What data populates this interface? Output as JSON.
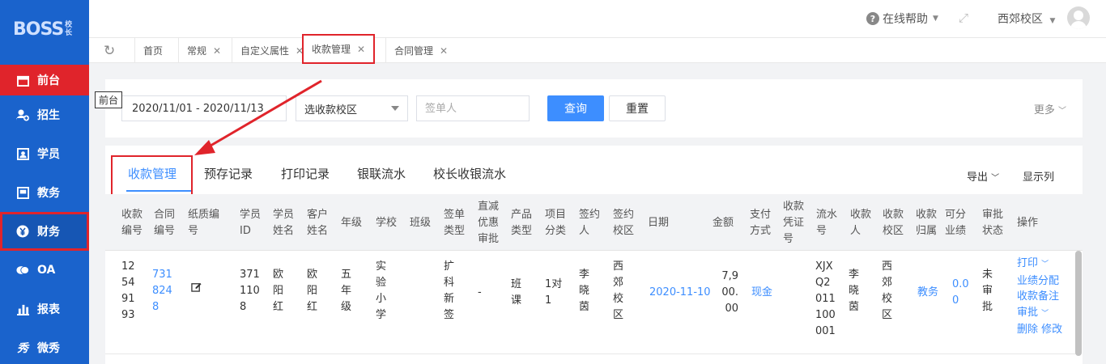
{
  "app": {
    "logo_text": "BOSS",
    "logo_sub": "校长"
  },
  "sidebar": {
    "items": [
      {
        "label": "前台",
        "icon": "calendar-icon"
      },
      {
        "label": "招生",
        "icon": "user-add-icon"
      },
      {
        "label": "学员",
        "icon": "id-card-icon"
      },
      {
        "label": "教务",
        "icon": "book-icon"
      },
      {
        "label": "财务",
        "icon": "yen-icon"
      },
      {
        "label": "OA",
        "icon": "chat-icon"
      },
      {
        "label": "报表",
        "icon": "bar-chart-icon"
      },
      {
        "label": "微秀",
        "icon": "xiu-icon"
      }
    ],
    "tooltip": "前台"
  },
  "header": {
    "help": "在线帮助",
    "campus": "西郊校区"
  },
  "page_tabs": [
    {
      "label": "首页",
      "closable": false
    },
    {
      "label": "常规",
      "closable": true
    },
    {
      "label": "自定义属性",
      "closable": true
    },
    {
      "label": "收款管理",
      "closable": true
    },
    {
      "label": "合同管理",
      "closable": true
    }
  ],
  "filter": {
    "date_range": "2020/11/01 - 2020/11/13",
    "campus_select": "选收款校区",
    "signer_placeholder": "签单人",
    "query": "查询",
    "reset": "重置",
    "more": "更多"
  },
  "sub_tabs": [
    "收款管理",
    "预存记录",
    "打印记录",
    "银联流水",
    "校长收银流水"
  ],
  "toolbar": {
    "export": "导出",
    "show_columns": "显示列"
  },
  "table": {
    "headers": [
      "收款编号",
      "合同编号",
      "纸质编号",
      "学员ID",
      "学员姓名",
      "客户姓名",
      "年级",
      "学校",
      "班级",
      "签单类型",
      "直减优惠审批",
      "产品类型",
      "项目分类",
      "签约人",
      "签约校区",
      "日期",
      "金额",
      "支付方式",
      "收款凭证号",
      "流水号",
      "收款人",
      "收款校区",
      "收款归属",
      "可分业绩",
      "审批状态",
      "操作"
    ],
    "rows": [
      {
        "receipt_no": "12549193",
        "contract_no": "7318248",
        "student_id": "3711108",
        "student_name": "欧阳红",
        "customer_name": "欧阳红",
        "grade": "五年级",
        "school": "实验小学",
        "class": "",
        "sign_type": "扩科新签",
        "discount_approval": "-",
        "product_type": "班课",
        "project_category": "1对1",
        "signer": "李晓茵",
        "sign_campus": "西郊校区",
        "date": "2020-11-10",
        "amount": "7,900.00",
        "pay_method": "现金",
        "voucher_no": "",
        "serial_no": "XJXQ2011100001",
        "receiver": "李晓茵",
        "receive_campus": "西郊校区",
        "belong": "教务",
        "performance": "0.00",
        "approval_status": "未审批",
        "actions": {
          "print": "打印",
          "perf_split": "业绩分配",
          "remark": "收款备注",
          "approve": "审批",
          "delete": "删除",
          "edit": "修改"
        }
      }
    ]
  }
}
